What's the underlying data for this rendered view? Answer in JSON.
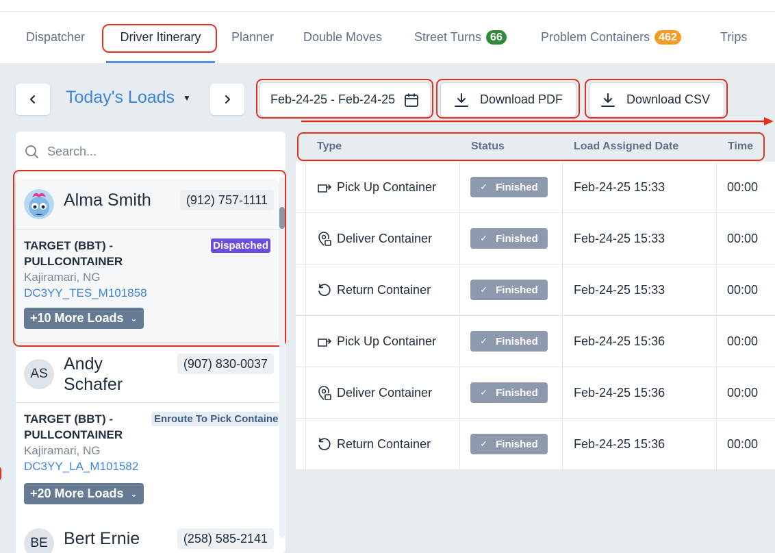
{
  "tabs": [
    {
      "label": "Dispatcher"
    },
    {
      "label": "Driver Itinerary",
      "active": true
    },
    {
      "label": "Planner"
    },
    {
      "label": "Double Moves"
    },
    {
      "label": "Street Turns",
      "badge": "66"
    },
    {
      "label": "Problem Containers",
      "badge": "462"
    },
    {
      "label": "Trips"
    }
  ],
  "toolbar": {
    "prev_icon": "chevron-left-icon",
    "next_icon": "chevron-right-icon",
    "loads_title": "Today's Loads",
    "date_range": "Feb-24-25 - Feb-24-25",
    "download_pdf": "Download PDF",
    "download_csv": "Download CSV"
  },
  "search": {
    "placeholder": "Search..."
  },
  "drivers": [
    {
      "name": "Alma Smith",
      "phone": "(912) 757-1111",
      "avatar": "alma-avatar-image",
      "load": {
        "customer": "TARGET (BBT) - PULLCONTAINER",
        "location": "Kajiramari, NG",
        "ref": "DC3YY_TES_M101858",
        "status": "Dispatched"
      },
      "more_loads": "+10 More Loads"
    },
    {
      "name_line1": "Andy",
      "name_line2": "Schafer",
      "initials": "AS",
      "phone": "(907) 830-0037",
      "load": {
        "customer": "TARGET (BBT) - PULLCONTAINER",
        "location": "Kajiramari, NG",
        "ref": "DC3YY_LA_M101582",
        "status": "Enroute To Pick Containe"
      },
      "more_loads": "+20 More Loads"
    },
    {
      "name": "Bert Ernie",
      "initials": "BE",
      "phone": "(258) 585-2141"
    }
  ],
  "table": {
    "headers": {
      "type": "Type",
      "status": "Status",
      "assigned": "Load Assigned Date",
      "time": "Time"
    },
    "rows": [
      {
        "type": "Pick Up Container",
        "icon": "pickup-container-icon",
        "status": "Finished",
        "date": "Feb-24-25 15:33",
        "time": "00:00"
      },
      {
        "type": "Deliver Container",
        "icon": "deliver-container-icon",
        "status": "Finished",
        "date": "Feb-24-25 15:33",
        "time": "00:00"
      },
      {
        "type": "Return Container",
        "icon": "return-container-icon",
        "status": "Finished",
        "date": "Feb-24-25 15:33",
        "time": "00:00"
      },
      {
        "type": "Pick Up Container",
        "icon": "pickup-container-icon",
        "status": "Finished",
        "date": "Feb-24-25 15:36",
        "time": "00:00"
      },
      {
        "type": "Deliver Container",
        "icon": "deliver-container-icon",
        "status": "Finished",
        "date": "Feb-24-25 15:36",
        "time": "00:00"
      },
      {
        "type": "Return Container",
        "icon": "return-container-icon",
        "status": "Finished",
        "date": "Feb-24-25 15:36",
        "time": "00:00"
      }
    ]
  },
  "colors": {
    "accent": "#3d84e0",
    "annotation": "#e3301d",
    "dispatched": "#6a4ee0",
    "finished": "#8d9aad"
  }
}
